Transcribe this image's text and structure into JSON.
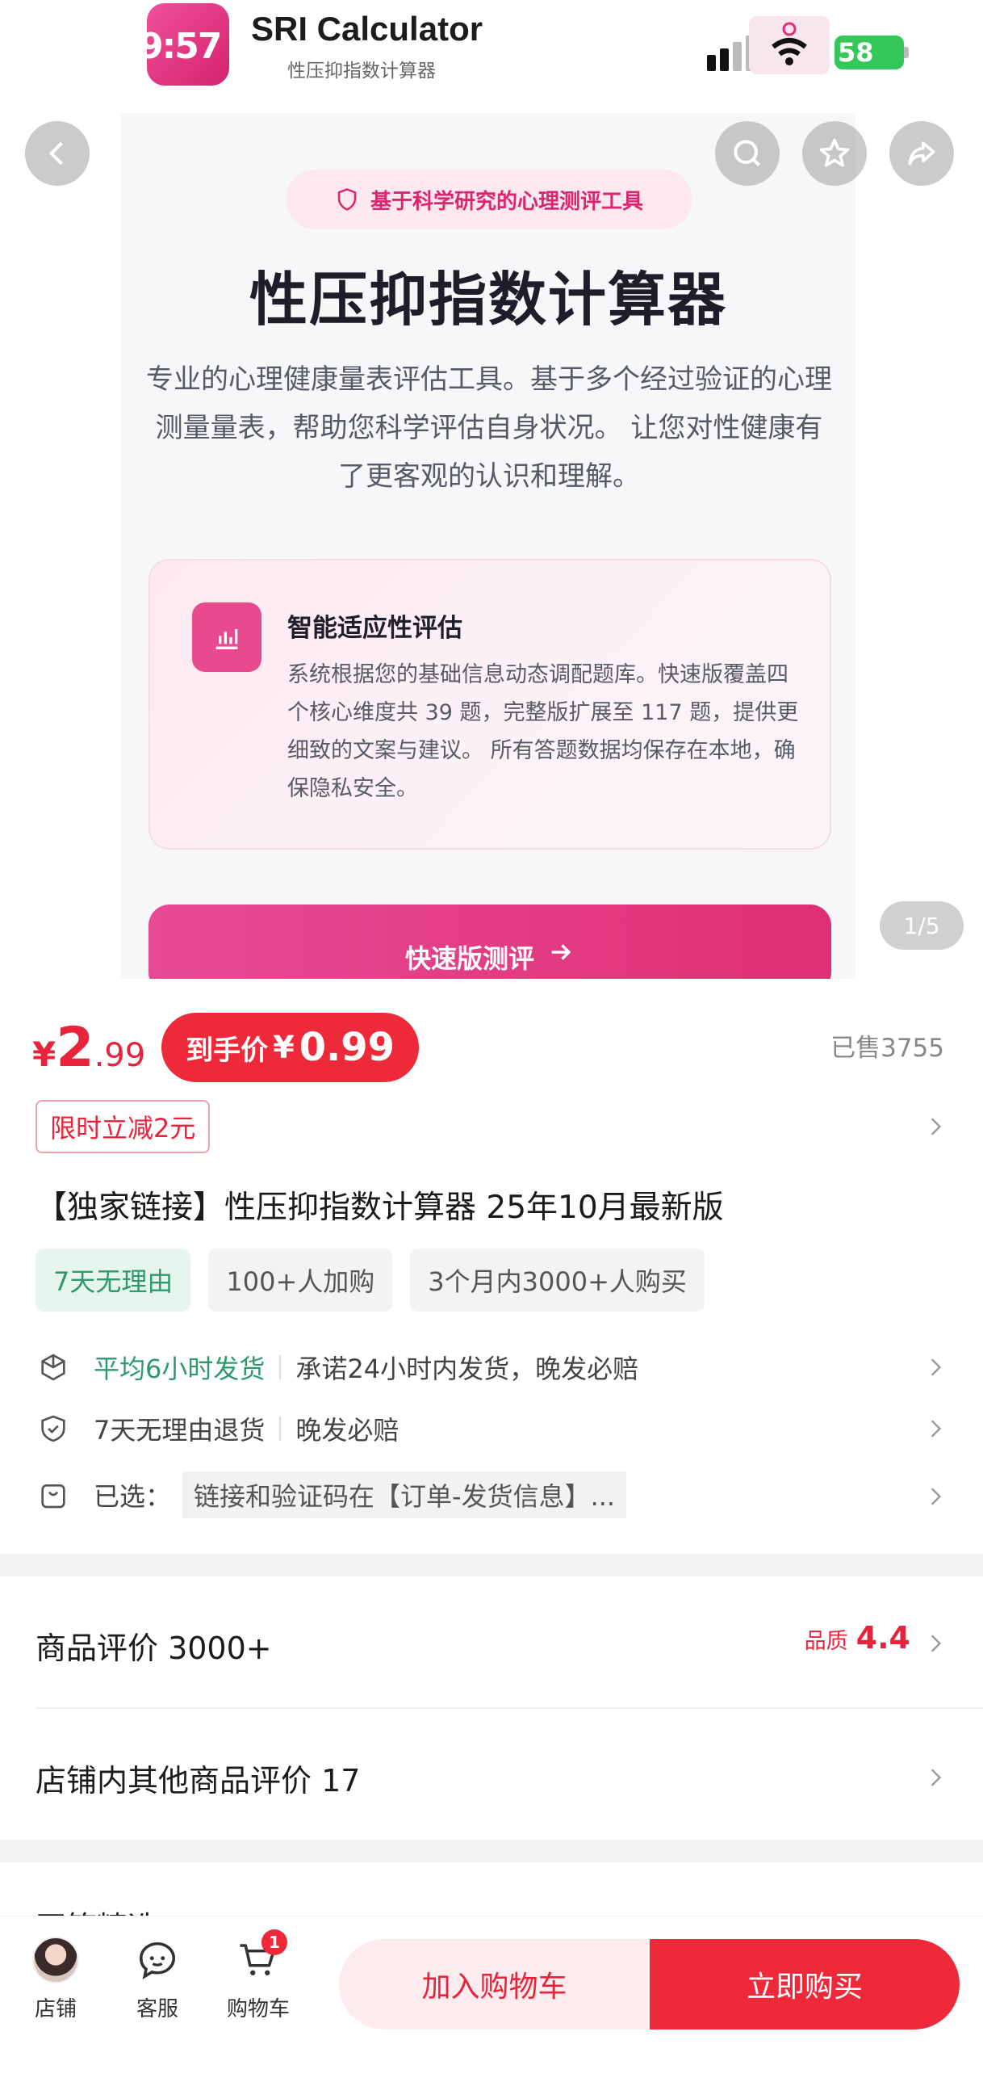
{
  "app": {
    "clock": "9:57",
    "title": "SRI Calculator",
    "subtitle": "性压抑指数计算器",
    "battery": "58"
  },
  "hero": {
    "tag": "基于科学研究的心理测评工具",
    "heading": "性压抑指数计算器",
    "description": "专业的心理健康量表评估工具。基于多个经过验证的心理测量量表，帮助您科学评估自身状况。 让您对性健康有了更客观的认识和理解。",
    "feature_title": "智能适应性评估",
    "feature_text": "系统根据您的基础信息动态调配题库。快速版覆盖四个核心维度共 39 题，完整版扩展至 117 题，提供更细致的文案与建议。 所有答题数据均保存在本地，确保隐私安全。",
    "quick_button": "快速版测评",
    "page_indicator": "1/5"
  },
  "product": {
    "currency": "¥",
    "price_int": "2",
    "price_dec": ".99",
    "final_label": "到手价",
    "final_currency": "¥",
    "final_value": "0.99",
    "sold": "已售3755",
    "promo": "限时立减2元",
    "title": "【独家链接】性压抑指数计算器  25年10月最新版",
    "chips": [
      "7天无理由",
      "100+人加购",
      "3个月内3000+人购买"
    ],
    "shipping_highlight": "平均6小时发货",
    "shipping_note": "承诺24小时内发货，晚发必赔",
    "returns": "7天无理由退货",
    "returns_note": "晚发必赔",
    "selected_label": "已选：",
    "selected_value": "链接和验证码在【订单-发货信息】..."
  },
  "reviews": {
    "product_reviews": "商品评价 3000+",
    "quality_label": "品质",
    "quality_value": "4.4",
    "store_reviews": "店铺内其他商品评价 17",
    "next_section": "开箱精选"
  },
  "bottom": {
    "store": "店铺",
    "service": "客服",
    "cart": "购物车",
    "cart_count": "1",
    "add_to_cart": "加入购物车",
    "buy_now": "立即购买"
  },
  "colors": {
    "accent_pink": "#e0307a",
    "price_red": "#e8233b",
    "success_green": "#2e9a6c"
  }
}
